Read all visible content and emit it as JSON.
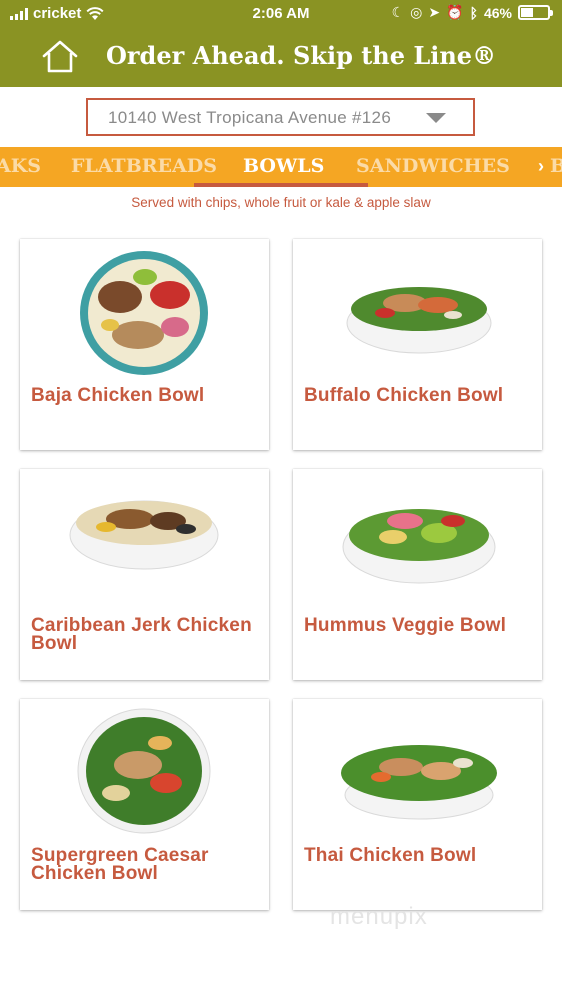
{
  "status_bar": {
    "carrier": "cricket",
    "time": "2:06 AM",
    "battery": "46%",
    "battery_level": 0.46
  },
  "header": {
    "title": "Order Ahead. Skip the Line®",
    "home_icon": "home-icon"
  },
  "location": {
    "value": "10140 West Tropicana Avenue #126"
  },
  "categories": {
    "tabs": [
      {
        "label": "AKS"
      },
      {
        "label": "FLATBREADS"
      },
      {
        "label": "BOWLS"
      },
      {
        "label": "SANDWICHES"
      },
      {
        "label": "BR"
      }
    ],
    "active": "BOWLS"
  },
  "note": "Served with chips, whole fruit or kale & apple slaw",
  "items": [
    {
      "name": "Baja Chicken Bowl"
    },
    {
      "name": "Buffalo Chicken Bowl"
    },
    {
      "name": "Caribbean Jerk Chicken Bowl"
    },
    {
      "name": "Hummus Veggie Bowl"
    },
    {
      "name": "Supergreen Caesar Chicken Bowl"
    },
    {
      "name": "Thai Chicken Bowl"
    }
  ],
  "watermark": "menupix",
  "colors": {
    "header": "#8a9323",
    "category_bar": "#f5a623",
    "accent": "#c65a3f"
  }
}
